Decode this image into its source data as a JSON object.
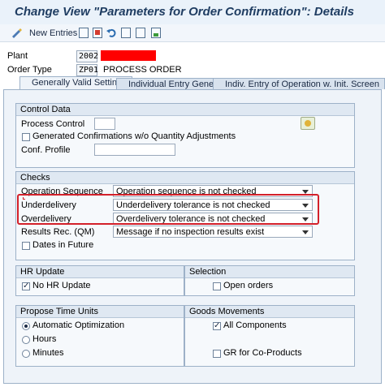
{
  "window": {
    "title": "Change View \"Parameters for Order Confirmation\": Details"
  },
  "toolbar": {
    "new_entries": "New Entries"
  },
  "header": {
    "plant_label": "Plant",
    "plant_value": "2002",
    "order_type_label": "Order Type",
    "order_type_value": "ZP01",
    "order_type_desc": "PROCESS ORDER"
  },
  "tabs": [
    {
      "label": "Generally Valid Settings"
    },
    {
      "label": "Individual Entry General"
    },
    {
      "label": "Indiv. Entry of Operation w. Init. Screen"
    }
  ],
  "control_data": {
    "title": "Control Data",
    "process_control_label": "Process Control",
    "process_control_value": "",
    "generated_confirmations_label": "Generated Confirmations w/o Quantity Adjustments",
    "generated_confirmations_checked": false,
    "conf_profile_label": "Conf. Profile",
    "conf_profile_value": ""
  },
  "checks": {
    "title": "Checks",
    "operation_sequence_label": "Operation Sequence",
    "operation_sequence_value": "Operation sequence is not checked",
    "underdelivery_label": "Underdelivery",
    "underdelivery_value": "Underdelivery tolerance is not checked",
    "overdelivery_label": "Overdelivery",
    "overdelivery_value": "Overdelivery tolerance is not checked",
    "results_rec_label": "Results Rec. (QM)",
    "results_rec_value": "Message if no inspection results exist",
    "dates_in_future_label": "Dates in Future",
    "dates_in_future_checked": false
  },
  "hr_update": {
    "title": "HR Update",
    "no_hr_update_label": "No HR Update",
    "no_hr_update_checked": true
  },
  "selection": {
    "title": "Selection",
    "open_orders_label": "Open orders",
    "open_orders_checked": false
  },
  "propose_time_units": {
    "title": "Propose Time Units",
    "options": [
      "Automatic Optimization",
      "Hours",
      "Minutes"
    ],
    "selected": "Automatic Optimization"
  },
  "goods_movements": {
    "title": "Goods Movements",
    "all_components_label": "All Components",
    "all_components_checked": true,
    "gr_coproducts_label": "GR for Co-Products",
    "gr_coproducts_checked": false
  },
  "colors": {
    "highlight": "#d3202a",
    "redaction": "#ff0000",
    "title_text": "#1f3d62"
  }
}
